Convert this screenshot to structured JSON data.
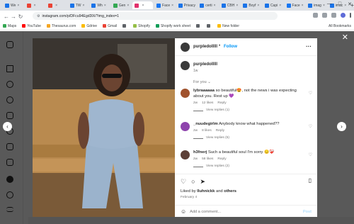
{
  "browser": {
    "tabs": [
      {
        "label": "We",
        "color": "#1a73e8"
      },
      {
        "label": "",
        "color": "#ea4335"
      },
      {
        "label": "",
        "color": "#ea4335"
      },
      {
        "label": "TW",
        "color": "#1a73e8"
      },
      {
        "label": "Wh",
        "color": "#1a73e8"
      },
      {
        "label": "Gen",
        "color": "#34a853"
      },
      {
        "label": "",
        "color": "#e1306c",
        "active": true
      },
      {
        "label": "Face",
        "color": "#1877f2"
      },
      {
        "label": "Privacy",
        "color": "#1a73e8"
      },
      {
        "label": "certi",
        "color": "#1a73e8"
      },
      {
        "label": "CBH",
        "color": "#1a73e8"
      },
      {
        "label": "Boyf",
        "color": "#1a73e8"
      },
      {
        "label": "Capi",
        "color": "#1a73e8"
      },
      {
        "label": "Face",
        "color": "#1877f2"
      },
      {
        "label": "imag",
        "color": "#1a73e8"
      },
      {
        "label": "imac",
        "color": "#1a73e8"
      }
    ],
    "new_tab": "+",
    "window_controls": {
      "minimize": "—",
      "maximize": "□",
      "close": "✕"
    },
    "nav": {
      "back": "←",
      "forward": "→",
      "reload": "↻"
    },
    "url": "instagram.com/p/DFcu94Egd3lX/?img_index=1",
    "bookmarks": [
      {
        "label": "Maps",
        "color": "#34a853"
      },
      {
        "label": "YouTube",
        "color": "#ff0000"
      },
      {
        "label": "Thesaurus.com",
        "color": "#f5a623"
      },
      {
        "label": "Gdrive",
        "color": "#fbbc04"
      },
      {
        "label": "Gmail",
        "color": "#ea4335"
      },
      {
        "label": "",
        "color": "#5f6368"
      },
      {
        "label": "Shopify",
        "color": "#95bf47"
      },
      {
        "label": "Shopify work sheet",
        "color": "#0f9d58"
      },
      {
        "label": "",
        "color": "#5f6368"
      },
      {
        "label": "",
        "color": "#5f6368"
      },
      {
        "label": "New folder",
        "color": "#fbbc04"
      }
    ],
    "all_bookmarks": "All Bookmarks"
  },
  "post": {
    "username": "purpledolllll",
    "follow": "Follow",
    "dot": "•",
    "more": "···",
    "caption_user": "purpledolllll",
    "caption_time": "1w",
    "for_you": "For you",
    "comments": [
      {
        "user": "lybraaaaaa",
        "text": "so beautiful😍, not the news i was expecting about you. Rest up 💜",
        "time": "2w",
        "likes": "12 likes",
        "reply": "Reply",
        "view": "View replies (1)",
        "avatar_color": "#a0522d"
      },
      {
        "user": "_nuudegirlm",
        "text": "Anybody know what happened??",
        "time": "2w",
        "likes": "8 likes",
        "reply": "Reply",
        "view": "View replies (5)",
        "avatar_color": "#8e44ad"
      },
      {
        "user": "h3fnerj",
        "text": "Such a beautiful soul I'm sorry 😔❤️‍🩹",
        "time": "2w",
        "likes": "58 likes",
        "reply": "Reply",
        "view": "View replies (2)",
        "avatar_color": "#5d4037"
      }
    ],
    "liked_by": "Liked by",
    "liked_user": "lluhnickk",
    "liked_and": "and",
    "liked_others": "others",
    "date": "February 4",
    "add_comment": "Add a comment...",
    "post_button": "Post"
  },
  "icons": {
    "heart": "♡",
    "comment": "○",
    "share": "➤",
    "bookmark": "⬜",
    "emoji": "☺",
    "prev": "‹",
    "next": "›",
    "close": "✕",
    "chev": "⌄"
  }
}
